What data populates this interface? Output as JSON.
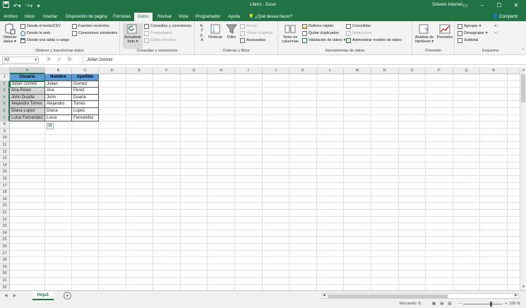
{
  "title_bar": {
    "document_title": "Libro1 - Excel",
    "account": "Solvetic Internet",
    "icons": [
      "save-icon",
      "undo-icon",
      "redo-icon",
      "customize-qat-icon"
    ],
    "window_controls": [
      "ribbon-display-icon",
      "minimize-icon",
      "maximize-icon",
      "close-icon"
    ]
  },
  "ribbon_tabs": {
    "tabs": [
      {
        "label": "Archivo"
      },
      {
        "label": "Inicio"
      },
      {
        "label": "Insertar"
      },
      {
        "label": "Disposición de página"
      },
      {
        "label": "Fórmulas"
      },
      {
        "label": "Datos"
      },
      {
        "label": "Revisar"
      },
      {
        "label": "Vista"
      },
      {
        "label": "Programador"
      },
      {
        "label": "Ayuda"
      }
    ],
    "active_tab": "Datos",
    "tell_me": "¿Qué desea hacer?",
    "share": "Compartir"
  },
  "ribbon": {
    "get_transform": {
      "label": "Obtener y transformar datos",
      "get_data": "Obtener datos",
      "from_text": "Desde el texto/CSV",
      "from_web": "Desde la web",
      "from_table": "Desde una tabla o rango",
      "recent_sources": "Fuentes recientes",
      "existing_connections": "Conexiones existentes"
    },
    "queries_connections": {
      "label": "Consultas y conexiones",
      "refresh_all": "Actualizar todo",
      "queries": "Consultas y conexiones",
      "properties": "Propiedades",
      "edit_links": "Editar vínculos"
    },
    "sort_filter": {
      "label": "Ordenar y filtrar",
      "sort": "Ordenar",
      "filter": "Filtro",
      "clear": "Borrar",
      "reapply": "Volver a aplicar",
      "advanced": "Avanzadas"
    },
    "data_tools": {
      "label": "Herramientas de datos",
      "text_to_columns": "Texto en columnas",
      "flash_fill": "Relleno rápido",
      "remove_duplicates": "Quitar duplicados",
      "data_validation": "Validación de datos",
      "consolidate": "Consolidar",
      "relationships": "Relaciones",
      "manage_data_model": "Administrar modelo de datos"
    },
    "forecast": {
      "label": "Previsión",
      "what_if": "Análisis de hipótesis",
      "forecast_sheet": "Previsión"
    },
    "outline": {
      "label": "Esquema",
      "group": "Agrupar",
      "ungroup": "Desagrupar",
      "subtotal": "Subtotal"
    }
  },
  "formula_bar": {
    "name_box": "A2",
    "cancel": "✕",
    "enter": "✓",
    "fx": "fx",
    "content": "Julian Gomez"
  },
  "sheet": {
    "columns": [
      "A",
      "B",
      "C",
      "D",
      "E",
      "F",
      "G",
      "H",
      "I",
      "J",
      "K",
      "L",
      "M",
      "N",
      "O",
      "P",
      "Q",
      "R",
      "S"
    ],
    "row_count": 32,
    "headers": [
      "Usuario",
      "Nombre",
      "Apellido"
    ],
    "rows": [
      [
        "Julian Gomez",
        "Julian",
        "Gomez"
      ],
      [
        "Ana Perez",
        "Ana",
        "Perez"
      ],
      [
        "John Duarte",
        "John",
        "Duarte"
      ],
      [
        "Alejandro Torres",
        "Alejandro",
        "Torres"
      ],
      [
        "Diana Lopez",
        "Diana",
        "Lopez"
      ],
      [
        "Luisa Fernandez",
        "Luisa",
        "Fernandez"
      ]
    ],
    "selected_column": "A",
    "selected_rows": [
      2,
      3,
      4,
      5,
      6,
      7
    ]
  },
  "sheet_tabs": {
    "tabs": [
      "Hoja1"
    ],
    "active": "Hoja1"
  },
  "status_bar": {
    "count": "Recuento: 6",
    "zoom": "100 %"
  },
  "colors": {
    "excel_green": "#217346",
    "header_fill": "#5b9bd5",
    "selection_fill": "#d6d6d6"
  }
}
